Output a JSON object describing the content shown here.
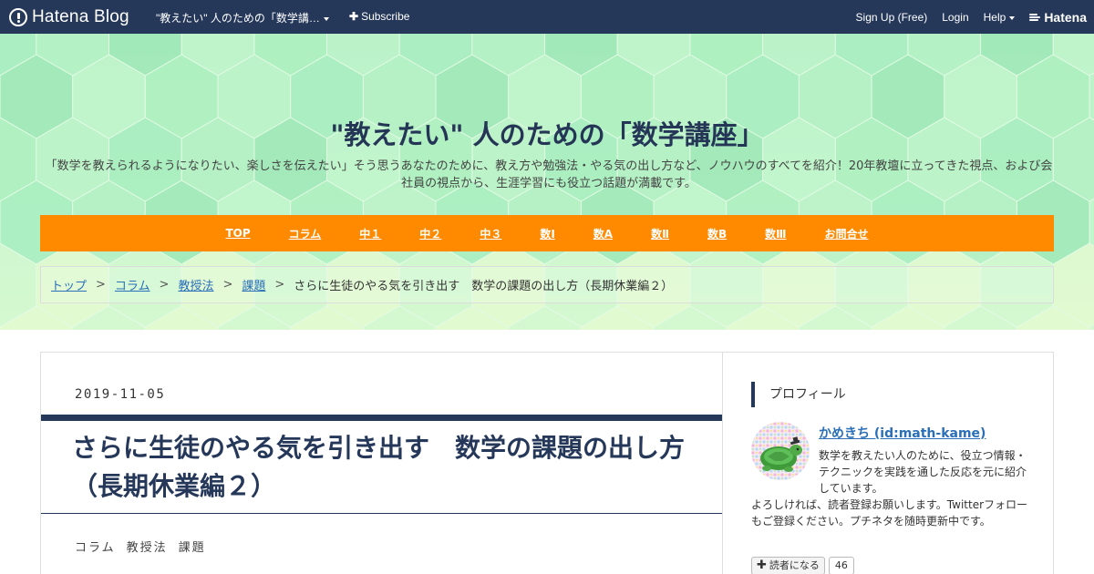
{
  "topbar": {
    "logo_text": "Hatena Blog",
    "blog_menu": "\"教えたい\" 人のための「数学講…",
    "subscribe": "Subscribe",
    "signup": "Sign Up (Free)",
    "login": "Login",
    "help": "Help",
    "hatena": "Hatena",
    "bar_color": "#26385a"
  },
  "header": {
    "title": "\"教えたい\" 人のための「数学講座」",
    "description": "「数学を教えられるようになりたい、楽しさを伝えたい」そう思うあなたのために、教え方や勉強法・やる気の出し方など、ノウハウのすべてを紹介！20年教壇に立ってきた視点、および会社員の視点から、生涯学習にも役立つ話題が満載です。"
  },
  "nav": {
    "color": "#ff8a00",
    "items": [
      {
        "label": "TOP"
      },
      {
        "label": "コラム"
      },
      {
        "label": "中１"
      },
      {
        "label": "中２"
      },
      {
        "label": "中３"
      },
      {
        "label": "数Ⅰ"
      },
      {
        "label": "数A"
      },
      {
        "label": "数Ⅱ"
      },
      {
        "label": "数B"
      },
      {
        "label": "数Ⅲ"
      },
      {
        "label": "お問合せ"
      }
    ]
  },
  "breadcrumb": {
    "items": [
      "トップ",
      "コラム",
      "教授法",
      "課題"
    ],
    "separator": ">",
    "current": "さらに生徒のやる気を引き出す　数学の課題の出し方（長期休業編２）"
  },
  "entry": {
    "date": "2019-11-05",
    "title": "さらに生徒のやる気を引き出す　数学の課題の出し方（長期休業編２）",
    "categories": [
      "コラム",
      "教授法",
      "課題"
    ]
  },
  "sidebar": {
    "heading": "プロフィール",
    "name": "かめきち (id:math-kame)",
    "description": "数学を教えたい人のために、役立つ情報・テクニックを実践を通した反応を元に紹介しています。",
    "extra": "よろしければ、読者登録お願いします。Twitterフォローもご登録ください。プチネタを随時更新中です。",
    "follow_label": "読者になる",
    "follow_count": "46"
  }
}
